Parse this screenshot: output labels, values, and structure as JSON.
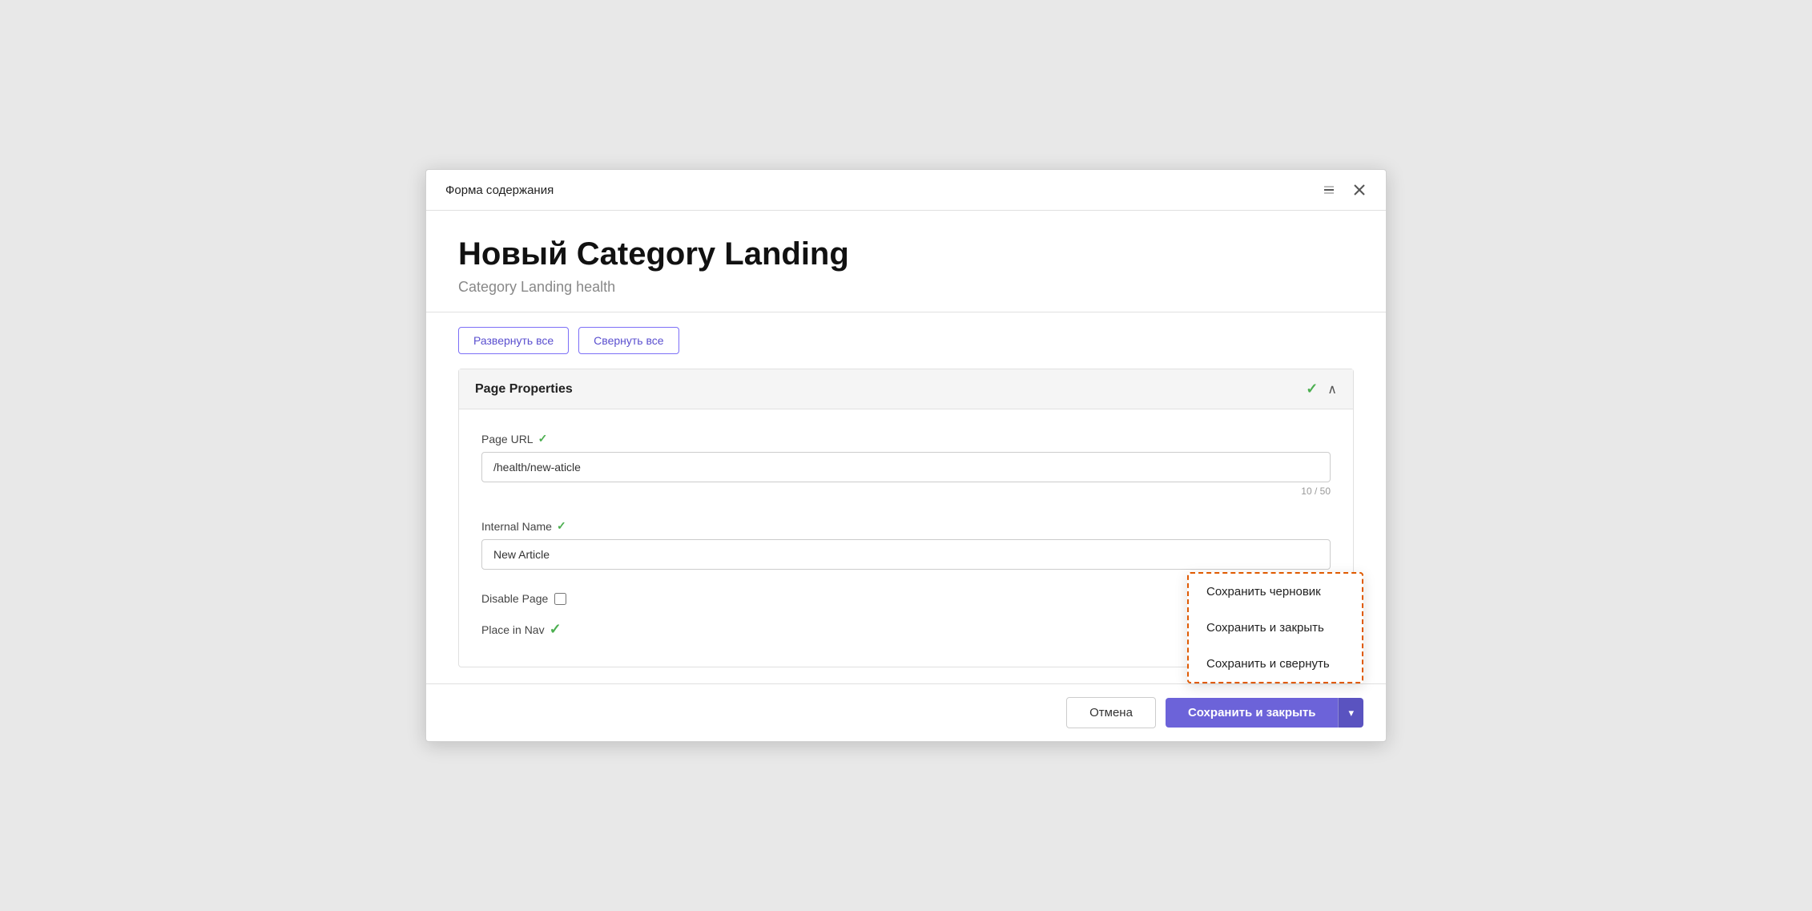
{
  "window": {
    "title": "Форма содержания",
    "minimize_label": "minimize",
    "close_label": "close"
  },
  "header": {
    "title": "Новый Category Landing",
    "subtitle": "Category Landing health"
  },
  "toolbar": {
    "expand_all": "Развернуть все",
    "collapse_all": "Свернуть все"
  },
  "section": {
    "title": "Page Properties",
    "check_icon": "✓",
    "chevron": "∧"
  },
  "fields": {
    "page_url": {
      "label": "Page URL",
      "value": "/health/new-aticle",
      "prefix": "/health/",
      "suffix": "new-aticle",
      "counter": "10 / 50",
      "check_icon": "✓"
    },
    "internal_name": {
      "label": "Internal Name",
      "value": "New Article",
      "check_icon": "✓"
    },
    "disable_page": {
      "label": "Disable Page"
    },
    "place_in_nav": {
      "label": "Place in Nav",
      "check_icon": "✓"
    }
  },
  "footer": {
    "cancel_label": "Отмена",
    "save_close_label": "Сохранить и закрыть",
    "arrow_icon": "▾"
  },
  "dropdown": {
    "items": [
      "Сохранить черновик",
      "Сохранить и закрыть",
      "Сохранить и свернуть"
    ]
  }
}
